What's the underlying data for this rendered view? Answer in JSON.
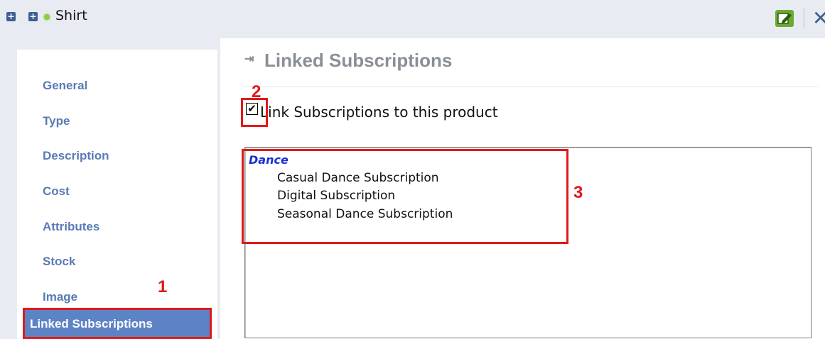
{
  "header": {
    "title": "Shirt",
    "icons": [
      "expand-icon",
      "expand-icon",
      "status-dot-icon",
      "edit-icon",
      "close-icon"
    ]
  },
  "sidebar": {
    "items": [
      {
        "label": "General"
      },
      {
        "label": "Type"
      },
      {
        "label": "Description"
      },
      {
        "label": "Cost"
      },
      {
        "label": "Attributes"
      },
      {
        "label": "Stock"
      },
      {
        "label": "Image"
      },
      {
        "label": "Linked Subscriptions",
        "active": true
      }
    ]
  },
  "main": {
    "title": "Linked Subscriptions",
    "link_checkbox": {
      "label": "Link Subscriptions to this product",
      "checked": true
    },
    "subscriptions": {
      "group": "Dance",
      "items": [
        "Casual Dance Subscription",
        "Digital Subscription",
        "Seasonal Dance Subscription"
      ]
    }
  },
  "annotations": {
    "callout1": "1",
    "callout2": "2",
    "callout3": "3"
  },
  "colors": {
    "accent": "#5d83c6",
    "annotation_red": "#e01a1a",
    "group_blue": "#1a2fd0"
  }
}
